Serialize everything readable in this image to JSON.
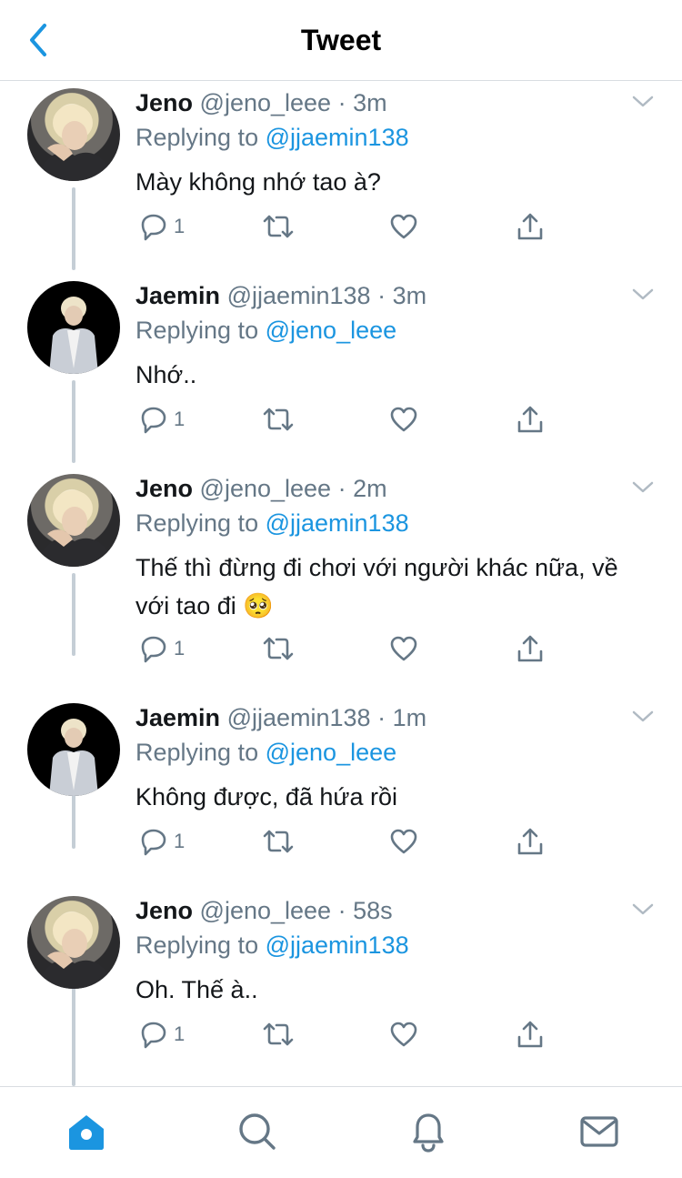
{
  "header": {
    "title": "Tweet",
    "back_icon": "chevron-left-icon",
    "accent": "#1b95e0"
  },
  "tweets": [
    {
      "name": "Jeno",
      "handle": "@jeno_leee",
      "sep": "·",
      "time": "3m",
      "replying_label": "Replying to",
      "reply_to": "@jjaemin138",
      "text": "Mày không nhớ tao à?",
      "reply_count": "1"
    },
    {
      "name": "Jaemin",
      "handle": "@jjaemin138",
      "sep": "·",
      "time": "3m",
      "replying_label": "Replying to",
      "reply_to": "@jeno_leee",
      "text": "Nhớ..",
      "reply_count": "1"
    },
    {
      "name": "Jeno",
      "handle": "@jeno_leee",
      "sep": "·",
      "time": "2m",
      "replying_label": "Replying to",
      "reply_to": "@jjaemin138",
      "text": "Thế thì đừng đi chơi với người khác nữa, về với tao đi 🥺",
      "reply_count": "1"
    },
    {
      "name": "Jaemin",
      "handle": "@jjaemin138",
      "sep": "·",
      "time": "1m",
      "replying_label": "Replying to",
      "reply_to": "@jeno_leee",
      "text": "Không được, đã hứa rồi",
      "reply_count": "1"
    },
    {
      "name": "Jeno",
      "handle": "@jeno_leee",
      "sep": "·",
      "time": "58s",
      "replying_label": "Replying to",
      "reply_to": "@jjaemin138",
      "text": "Oh. Thế à..",
      "reply_count": "1"
    }
  ],
  "action_icons": [
    "reply-icon",
    "retweet-icon",
    "like-icon",
    "share-icon"
  ],
  "tab_bar": [
    "home-icon",
    "search-icon",
    "notifications-icon",
    "messages-icon"
  ]
}
